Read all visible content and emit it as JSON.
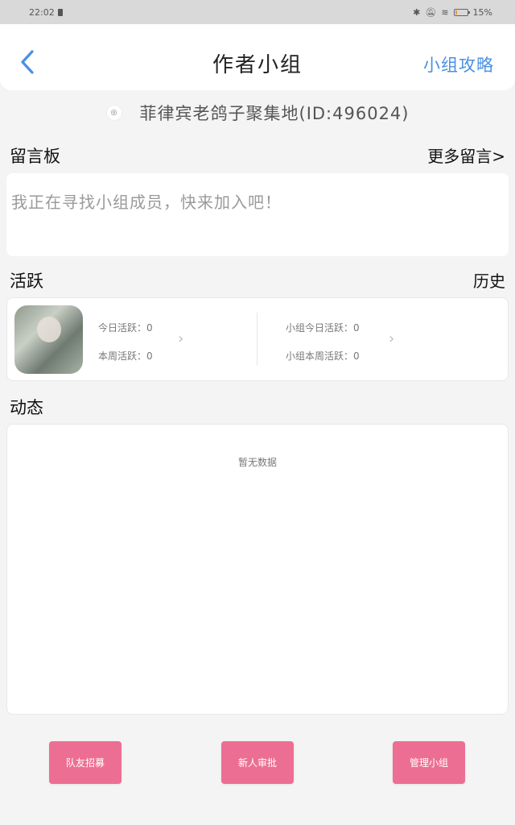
{
  "status_bar": {
    "time": "22:02",
    "battery_text": "15%",
    "battery_level": 0.15
  },
  "header": {
    "title": "作者小组",
    "right_link": "小组攻略"
  },
  "group": {
    "name": "菲律宾老鸽子聚集地(ID:496024)"
  },
  "message_board": {
    "title": "留言板",
    "more": "更多留言>",
    "content": "我正在寻找小组成员，快来加入吧！"
  },
  "activity": {
    "title": "活跃",
    "history": "历史",
    "today_label": "今日活跃：0",
    "week_label": "本周活跃：0",
    "group_today_label": "小组今日活跃：0",
    "group_week_label": "小组本周活跃：0"
  },
  "feed": {
    "title": "动态",
    "empty": "暂无数据"
  },
  "buttons": {
    "recruit": "队友招募",
    "newbie": "新人审批",
    "manage": "管理小组"
  },
  "colors": {
    "accent_blue": "#4a90e2",
    "button_pink": "#ec6f93"
  }
}
